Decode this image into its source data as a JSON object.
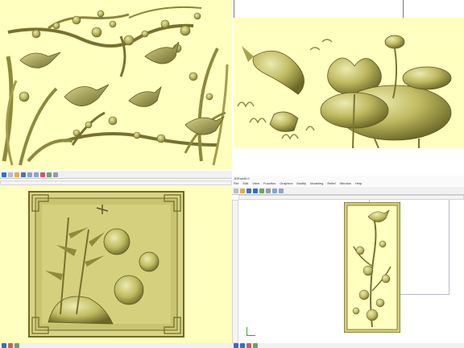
{
  "panels": {
    "top_left": {
      "name": "birds-plum-blossom-relief"
    },
    "top_right": {
      "name": "koi-lotus-relief"
    },
    "bottom_left": {
      "name": "bamboo-chrysanthemum-framed-relief"
    },
    "bottom_right": {
      "name": "vertical-bird-flower-relief"
    }
  },
  "bottom_right_window": {
    "title": "JDPaint5.0",
    "menu": [
      "File",
      "Edit",
      "View",
      "Function",
      "Graphics",
      "Modify",
      "Modeling",
      "Relief",
      "Window",
      "Help"
    ]
  },
  "colors": {
    "background_relief": "#ffffbf",
    "relief_base": "#c3c067",
    "relief_dark": "#6f6a2a",
    "relief_highlight": "#e7e4a6",
    "toolbar": "#f1f1f1",
    "accent_blue": "#2d6fd1"
  },
  "icons": [
    "window-icon",
    "new-file-icon",
    "open-folder-icon",
    "save-icon",
    "undo-icon",
    "redo-icon",
    "select-icon",
    "zoom-icon",
    "pan-icon"
  ]
}
